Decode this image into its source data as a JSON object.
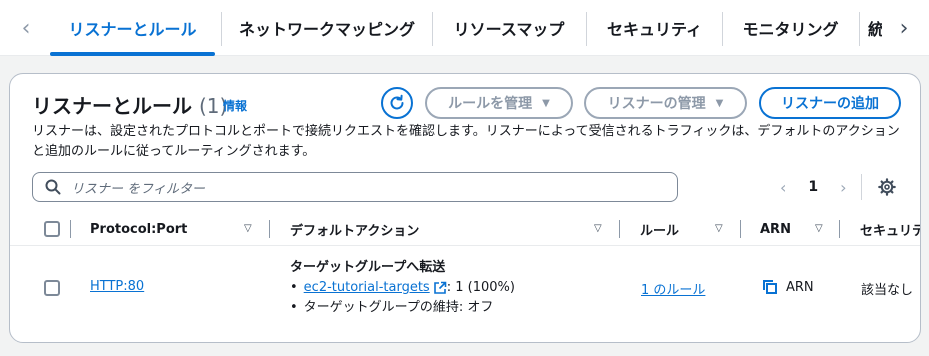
{
  "tabs": [
    {
      "label": "リスナーとルール",
      "active": true
    },
    {
      "label": "ネットワークマッピング"
    },
    {
      "label": "リソースマップ"
    },
    {
      "label": "セキュリティ"
    },
    {
      "label": "モニタリング"
    },
    {
      "label": "統"
    }
  ],
  "panel": {
    "title": "リスナーとルール",
    "count": "(1)",
    "info_label": "情報",
    "manage_rules_label": "ルールを管理",
    "manage_listeners_label": "リスナーの管理",
    "add_listener_label": "リスナーの追加",
    "description": "リスナーは、設定されたプロトコルとポートで接続リクエストを確認します。リスナーによって受信されるトラフィックは、デフォルトのアクションと追加のルールに従ってルーティングされます。",
    "search_placeholder": "リスナー をフィルター",
    "page_number": "1"
  },
  "table": {
    "headers": {
      "protocol_port": "Protocol:Port",
      "default_action": "デフォルトアクション",
      "rules": "ルール",
      "arn": "ARN",
      "security": "セキュリティ"
    },
    "rows": [
      {
        "protocol_port": "HTTP:80",
        "action_title": "ターゲットグループへ転送",
        "target_group": "ec2-tutorial-targets",
        "weight": ": 1 (100%)",
        "stickiness": "ターゲットグループの維持: オフ",
        "rules_link": "1 のルール",
        "arn_label": "ARN",
        "security": "該当なし"
      }
    ]
  },
  "colors": {
    "accent": "#0972d3",
    "disabled": "#8d99a8",
    "background": "#f2f3f3"
  }
}
